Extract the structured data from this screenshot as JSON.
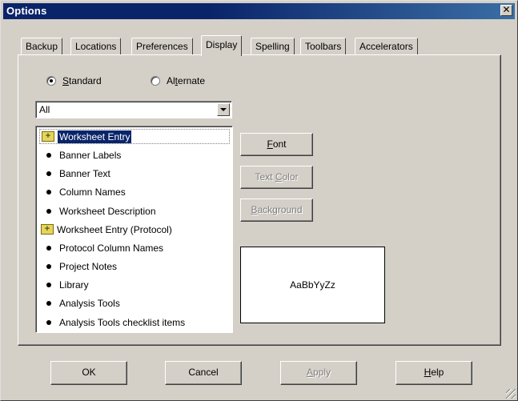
{
  "window": {
    "title": "Options",
    "close_label": "✕"
  },
  "tabs": [
    {
      "label": "Backup",
      "active": false
    },
    {
      "label": "Locations",
      "active": false
    },
    {
      "label": "Preferences",
      "active": false
    },
    {
      "label": "Display",
      "active": true
    },
    {
      "label": "Spelling",
      "active": false
    },
    {
      "label": "Toolbars",
      "active": false
    },
    {
      "label": "Accelerators",
      "active": false
    }
  ],
  "radios": {
    "standard": {
      "mnemonic": "S",
      "rest": "tandard",
      "checked": true
    },
    "alternate": {
      "pre": "Al",
      "mnemonic": "t",
      "rest": "ernate",
      "checked": false
    }
  },
  "filter_combo": {
    "value": "All"
  },
  "list_items": [
    {
      "label": "Worksheet Entry",
      "icon": "folder-plus-icon",
      "selected": true
    },
    {
      "label": "Banner Labels",
      "icon": "bullet-icon"
    },
    {
      "label": "Banner Text",
      "icon": "bullet-icon"
    },
    {
      "label": "Column Names",
      "icon": "bullet-icon"
    },
    {
      "label": "Worksheet Description",
      "icon": "bullet-icon"
    },
    {
      "label": "Worksheet Entry (Protocol)",
      "icon": "folder-plus-icon"
    },
    {
      "label": "Protocol Column Names",
      "icon": "bullet-icon"
    },
    {
      "label": "Project Notes",
      "icon": "bullet-icon"
    },
    {
      "label": "Library",
      "icon": "bullet-icon"
    },
    {
      "label": "Analysis Tools",
      "icon": "bullet-icon"
    },
    {
      "label": "Analysis Tools checklist items",
      "icon": "bullet-icon"
    }
  ],
  "side_buttons": {
    "font": {
      "mnemonic": "F",
      "rest": "ont",
      "enabled": true
    },
    "text_color": {
      "pre": "Text ",
      "mnemonic": "C",
      "rest": "olor",
      "enabled": false
    },
    "background": {
      "mnemonic": "B",
      "rest": "ackground",
      "enabled": false
    }
  },
  "preview": {
    "sample_text": "AaBbYyZz"
  },
  "bottom_buttons": {
    "ok": {
      "label": "OK",
      "enabled": true
    },
    "cancel": {
      "label": "Cancel",
      "enabled": true
    },
    "apply": {
      "mnemonic": "A",
      "rest": "pply",
      "enabled": false
    },
    "help": {
      "mnemonic": "H",
      "rest": "elp",
      "enabled": true
    }
  },
  "colors": {
    "face": "#d4d0c8",
    "titlebar": "#0a246a",
    "selection": "#0a246a"
  }
}
